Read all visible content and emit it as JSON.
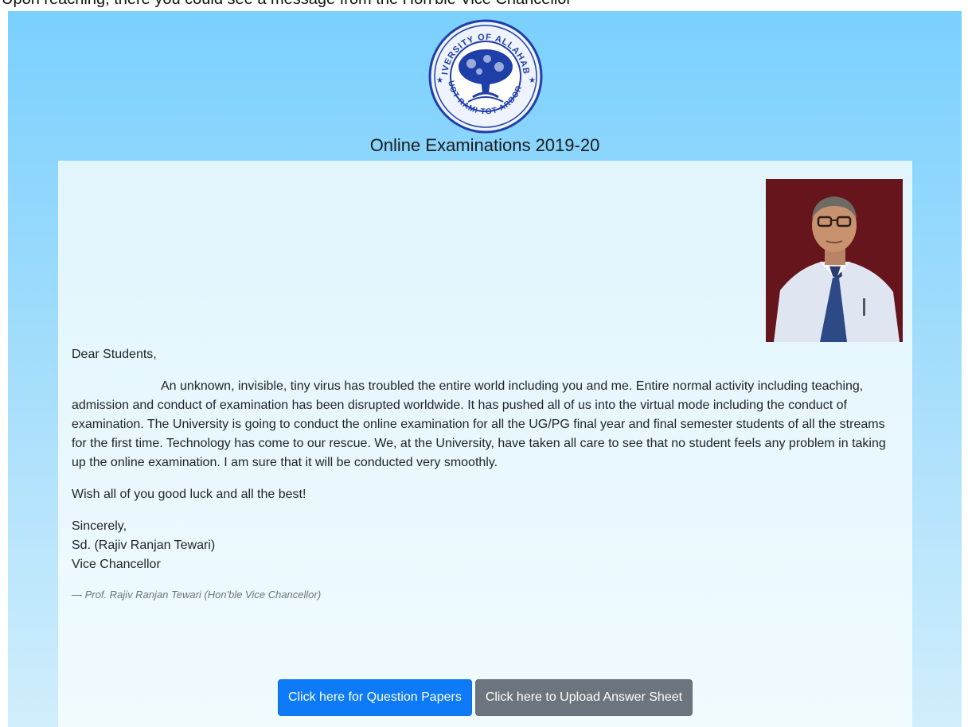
{
  "caption": "Upon reaching, there you could see a message from the Hon'ble Vice Chancellor",
  "logo": {
    "top_arc_text": "UNIVERSITY OF ALLAHABAD",
    "bottom_arc_text": "QUOT RAMI TOT ARBORES",
    "color": "#1f3fa8"
  },
  "header": {
    "title": "Online Examinations 2019-20"
  },
  "letter": {
    "salutation": "Dear Students,",
    "body": "An unknown, invisible, tiny virus has troubled the entire world including you and me. Entire normal activity including teaching, admission and conduct of examination has been disrupted worldwide. It has pushed all of us into the virtual mode including the conduct of examination. The University is going to conduct the online examination for all the UG/PG final year and final semester students of all the streams for the first time. Technology has come to our rescue. We, at the University, have taken all care to see that no student feels any problem in taking up the online examination. I am sure that it will be conducted very smoothly.",
    "wish": "Wish all of you good luck and all the best!",
    "closing": "Sincerely,",
    "signed": "Sd. (Rajiv Ranjan Tewari)",
    "designation": "Vice Chancellor",
    "attribution": "— Prof. Rajiv Ranjan Tewari (Hon'ble Vice Chancellor)"
  },
  "buttons": {
    "question_papers": "Click here for Question Papers",
    "upload_answer": "Click here to Upload Answer Sheet"
  },
  "colors": {
    "page_gradient_top": "#7ad0fe",
    "card_background": "#e1f5fd",
    "primary_button": "#0d7bf7",
    "secondary_button": "#6c757d"
  }
}
